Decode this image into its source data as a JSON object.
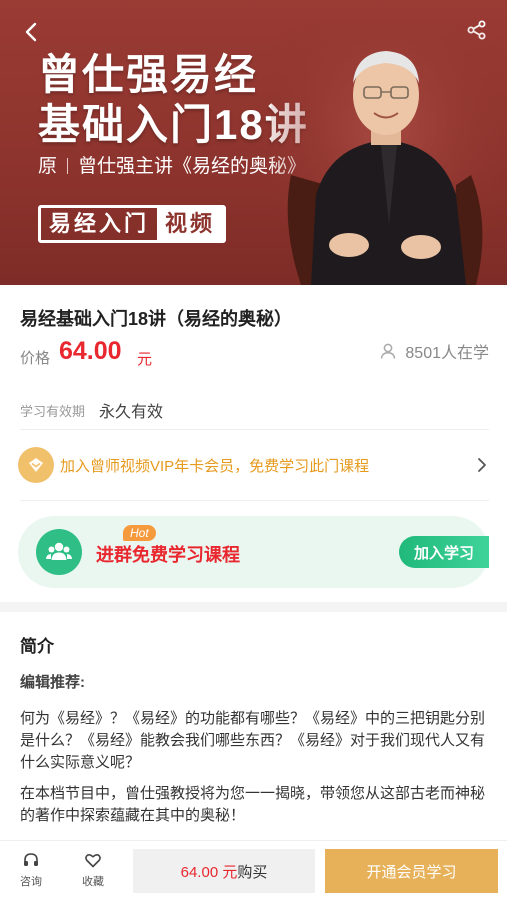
{
  "banner": {
    "title_line1": "曾仕强易经",
    "title_line2": "基础入门18讲",
    "subtitle_prefix": "原",
    "subtitle_text": "曾仕强主讲《易经的奥秘》",
    "tag_part1": "易经入门",
    "tag_part2": "视频",
    "back_icon": "chevron-left-icon",
    "share_icon": "share-icon"
  },
  "course": {
    "name": "易经基础入门18讲（易经的奥秘）",
    "price_label": "价格",
    "price_value": "64.00",
    "price_unit": "元",
    "learners": "8501人在学",
    "validity_label": "学习有效期",
    "validity_value": "永久有效"
  },
  "vip_promo": {
    "text": "加入曾师视频VIP年卡会员，免费学习此门课程"
  },
  "group": {
    "hot_badge": "Hot",
    "text": "进群免费学习课程",
    "button": "加入学习"
  },
  "intro": {
    "title": "简介",
    "subtitle": "编辑推荐:",
    "paragraph1": "何为《易经》？《易经》的功能都有哪些？《易经》中的三把钥匙分别是什么？《易经》能教会我们哪些东西？《易经》对于我们现代人又有什么实际意义呢？",
    "paragraph2": "在本档节目中，曾仕强教授将为您一一揭晓，带领您从这部古老而神秘的著作中探索蕴藏在其中的奥秘！"
  },
  "bottom_bar": {
    "consult_label": "咨询",
    "favorite_label": "收藏",
    "buy_price": "64.00 元",
    "buy_label": "购买",
    "vip_button": "开通会员学习"
  },
  "colors": {
    "banner_bg": "#8d332d",
    "price_red": "#e8272e",
    "vip_orange": "#e69a1e",
    "group_green": "#2fbf86",
    "vip_button_gold": "#e6b158"
  }
}
